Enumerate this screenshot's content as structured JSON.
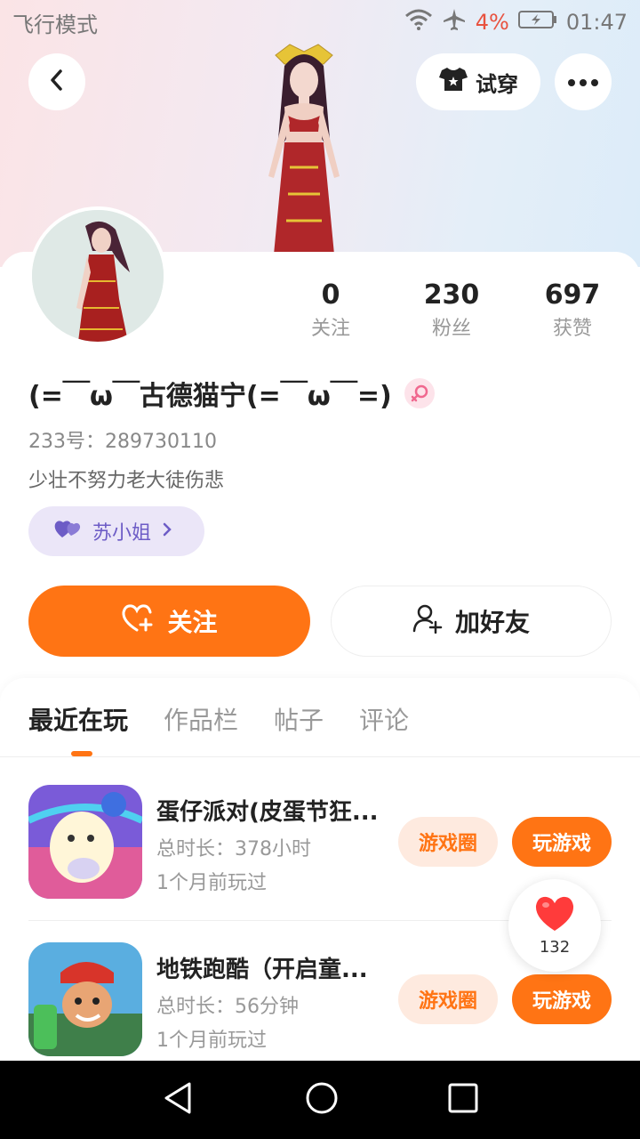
{
  "status_bar": {
    "carrier_text": "飞行模式",
    "battery_percent": "4%",
    "time": "01:47",
    "icons": [
      "wifi-icon",
      "airplane-icon",
      "battery-charging-icon"
    ]
  },
  "header": {
    "back_icon": "chevron-left-icon",
    "try_on_label": "试穿",
    "try_on_icon": "tshirt-icon",
    "more_icon": "more-dots-icon"
  },
  "profile": {
    "stats": [
      {
        "value": "0",
        "label": "关注"
      },
      {
        "value": "230",
        "label": "粉丝"
      },
      {
        "value": "697",
        "label": "获赞"
      }
    ],
    "nickname": "(=￣ω￣古德猫宁(=￣ω￣=)",
    "gender_icon": "female-icon",
    "uid": "233号：289730110",
    "bio": "少壮不努力老大徒伤悲",
    "cp_label": "苏小姐",
    "follow_label": "关注",
    "add_friend_label": "加好友"
  },
  "tabs": [
    {
      "label": "最近在玩",
      "active": true
    },
    {
      "label": "作品栏",
      "active": false
    },
    {
      "label": "帖子",
      "active": false
    },
    {
      "label": "评论",
      "active": false
    }
  ],
  "games": [
    {
      "title": "蛋仔派对(皮蛋节狂...",
      "duration": "总时长：378小时",
      "last_played": "1个月前玩过",
      "circle_label": "游戏圈",
      "play_label": "玩游戏"
    },
    {
      "title": "地铁跑酷（开启童...",
      "duration": "总时长：56分钟",
      "last_played": "1个月前玩过",
      "circle_label": "游戏圈",
      "play_label": "玩游戏"
    }
  ],
  "like_float": {
    "count": "132"
  },
  "colors": {
    "accent": "#ff7414",
    "cp_purple": "#6d5cc6",
    "battery_low": "#e8523f"
  }
}
